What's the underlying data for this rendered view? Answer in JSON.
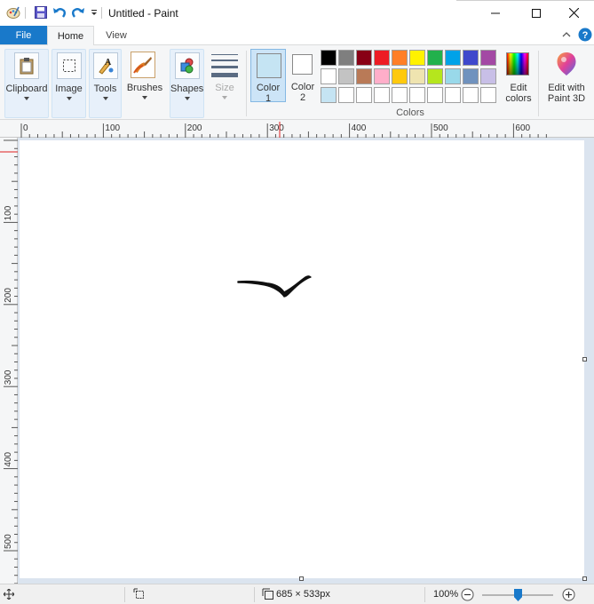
{
  "window": {
    "title": "Untitled - Paint",
    "controls": [
      "minimize",
      "maximize",
      "close"
    ]
  },
  "quick_access": {
    "items": [
      "app-menu-icon",
      "save-icon",
      "undo-icon",
      "redo-icon",
      "customize-dropdown-icon"
    ]
  },
  "tabs": {
    "file": "File",
    "home": "Home",
    "view": "View"
  },
  "ribbon": {
    "clipboard": "Clipboard",
    "image": "Image",
    "tools": "Tools",
    "brushes": "Brushes",
    "shapes": "Shapes",
    "size": "Size",
    "color1_line1": "Color",
    "color1_line2": "1",
    "color2_line1": "Color",
    "color2_line2": "2",
    "colors_group": "Colors",
    "edit_colors_line1": "Edit",
    "edit_colors_line2": "colors",
    "paint3d_line1": "Edit with",
    "paint3d_line2": "Paint 3D"
  },
  "palette": {
    "row1": [
      "#000000",
      "#7f7f7f",
      "#880015",
      "#ed1c24",
      "#ff7f27",
      "#fff200",
      "#22b14c",
      "#00a2e8",
      "#3f48cc",
      "#a349a4"
    ],
    "row2": [
      "#ffffff",
      "#c3c3c3",
      "#b97a57",
      "#ffaec9",
      "#ffc90e",
      "#efe4b0",
      "#b5e61d",
      "#99d9ea",
      "#7092be",
      "#c8bfe7"
    ],
    "row3": [
      "#c5e4f3",
      "#ffffff",
      "#ffffff",
      "#ffffff",
      "#ffffff",
      "#ffffff",
      "#ffffff",
      "#ffffff",
      "#ffffff",
      "#ffffff"
    ],
    "color1": "#c5e4f3",
    "color2": "#ffffff"
  },
  "rulers": {
    "horizontal": [
      "0",
      "100",
      "200",
      "300",
      "400",
      "500",
      "600"
    ],
    "vertical": [
      "100",
      "200",
      "300",
      "400",
      "500"
    ]
  },
  "status": {
    "dimensions": "685 × 533px",
    "zoom": "100%",
    "zoom_level": 1.0
  }
}
